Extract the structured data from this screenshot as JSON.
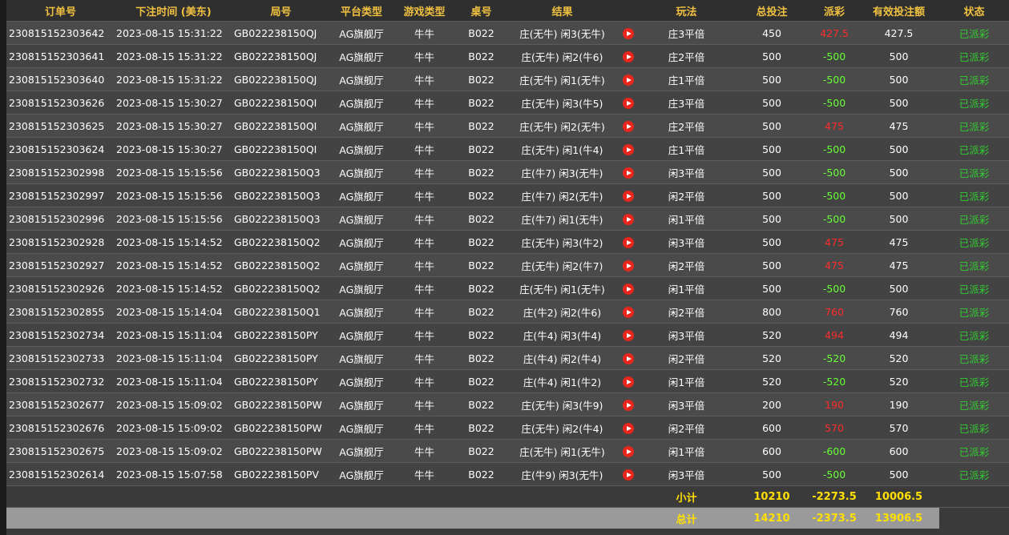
{
  "colors": {
    "header_text": "#f0c040",
    "win": "#ff2a2a",
    "loss": "#66ff33",
    "status": "#33cc33",
    "total_text": "#ffe000"
  },
  "headers": [
    "订单号",
    "下注时间 (美东)",
    "局号",
    "平台类型",
    "游戏类型",
    "桌号",
    "结果",
    "",
    "玩法",
    "总投注",
    "派彩",
    "有效投注额",
    "状态"
  ],
  "rows": [
    {
      "order": "230815152303642",
      "time": "2023-08-15 15:31:22",
      "round": "GB022238150QJ",
      "platform": "AG旗舰厅",
      "game": "牛牛",
      "table": "B022",
      "result": "庄(无牛) 闲3(无牛)",
      "play": "庄3平倍",
      "bet": "450",
      "payout": "427.5",
      "payout_type": "win",
      "valid": "427.5",
      "status": "已派彩"
    },
    {
      "order": "230815152303641",
      "time": "2023-08-15 15:31:22",
      "round": "GB022238150QJ",
      "platform": "AG旗舰厅",
      "game": "牛牛",
      "table": "B022",
      "result": "庄(无牛) 闲2(牛6)",
      "play": "庄2平倍",
      "bet": "500",
      "payout": "-500",
      "payout_type": "loss",
      "valid": "500",
      "status": "已派彩"
    },
    {
      "order": "230815152303640",
      "time": "2023-08-15 15:31:22",
      "round": "GB022238150QJ",
      "platform": "AG旗舰厅",
      "game": "牛牛",
      "table": "B022",
      "result": "庄(无牛) 闲1(无牛)",
      "play": "庄1平倍",
      "bet": "500",
      "payout": "-500",
      "payout_type": "loss",
      "valid": "500",
      "status": "已派彩"
    },
    {
      "order": "230815152303626",
      "time": "2023-08-15 15:30:27",
      "round": "GB022238150QI",
      "platform": "AG旗舰厅",
      "game": "牛牛",
      "table": "B022",
      "result": "庄(无牛) 闲3(牛5)",
      "play": "庄3平倍",
      "bet": "500",
      "payout": "-500",
      "payout_type": "loss",
      "valid": "500",
      "status": "已派彩"
    },
    {
      "order": "230815152303625",
      "time": "2023-08-15 15:30:27",
      "round": "GB022238150QI",
      "platform": "AG旗舰厅",
      "game": "牛牛",
      "table": "B022",
      "result": "庄(无牛) 闲2(无牛)",
      "play": "庄2平倍",
      "bet": "500",
      "payout": "475",
      "payout_type": "win",
      "valid": "475",
      "status": "已派彩"
    },
    {
      "order": "230815152303624",
      "time": "2023-08-15 15:30:27",
      "round": "GB022238150QI",
      "platform": "AG旗舰厅",
      "game": "牛牛",
      "table": "B022",
      "result": "庄(无牛) 闲1(牛4)",
      "play": "庄1平倍",
      "bet": "500",
      "payout": "-500",
      "payout_type": "loss",
      "valid": "500",
      "status": "已派彩"
    },
    {
      "order": "230815152302998",
      "time": "2023-08-15 15:15:56",
      "round": "GB022238150Q3",
      "platform": "AG旗舰厅",
      "game": "牛牛",
      "table": "B022",
      "result": "庄(牛7) 闲3(无牛)",
      "play": "闲3平倍",
      "bet": "500",
      "payout": "-500",
      "payout_type": "loss",
      "valid": "500",
      "status": "已派彩"
    },
    {
      "order": "230815152302997",
      "time": "2023-08-15 15:15:56",
      "round": "GB022238150Q3",
      "platform": "AG旗舰厅",
      "game": "牛牛",
      "table": "B022",
      "result": "庄(牛7) 闲2(无牛)",
      "play": "闲2平倍",
      "bet": "500",
      "payout": "-500",
      "payout_type": "loss",
      "valid": "500",
      "status": "已派彩"
    },
    {
      "order": "230815152302996",
      "time": "2023-08-15 15:15:56",
      "round": "GB022238150Q3",
      "platform": "AG旗舰厅",
      "game": "牛牛",
      "table": "B022",
      "result": "庄(牛7) 闲1(无牛)",
      "play": "闲1平倍",
      "bet": "500",
      "payout": "-500",
      "payout_type": "loss",
      "valid": "500",
      "status": "已派彩"
    },
    {
      "order": "230815152302928",
      "time": "2023-08-15 15:14:52",
      "round": "GB022238150Q2",
      "platform": "AG旗舰厅",
      "game": "牛牛",
      "table": "B022",
      "result": "庄(无牛) 闲3(牛2)",
      "play": "闲3平倍",
      "bet": "500",
      "payout": "475",
      "payout_type": "win",
      "valid": "475",
      "status": "已派彩"
    },
    {
      "order": "230815152302927",
      "time": "2023-08-15 15:14:52",
      "round": "GB022238150Q2",
      "platform": "AG旗舰厅",
      "game": "牛牛",
      "table": "B022",
      "result": "庄(无牛) 闲2(牛7)",
      "play": "闲2平倍",
      "bet": "500",
      "payout": "475",
      "payout_type": "win",
      "valid": "475",
      "status": "已派彩"
    },
    {
      "order": "230815152302926",
      "time": "2023-08-15 15:14:52",
      "round": "GB022238150Q2",
      "platform": "AG旗舰厅",
      "game": "牛牛",
      "table": "B022",
      "result": "庄(无牛) 闲1(无牛)",
      "play": "闲1平倍",
      "bet": "500",
      "payout": "-500",
      "payout_type": "loss",
      "valid": "500",
      "status": "已派彩"
    },
    {
      "order": "230815152302855",
      "time": "2023-08-15 15:14:04",
      "round": "GB022238150Q1",
      "platform": "AG旗舰厅",
      "game": "牛牛",
      "table": "B022",
      "result": "庄(牛2) 闲2(牛6)",
      "play": "闲2平倍",
      "bet": "800",
      "payout": "760",
      "payout_type": "win",
      "valid": "760",
      "status": "已派彩"
    },
    {
      "order": "230815152302734",
      "time": "2023-08-15 15:11:04",
      "round": "GB022238150PY",
      "platform": "AG旗舰厅",
      "game": "牛牛",
      "table": "B022",
      "result": "庄(牛4) 闲3(牛4)",
      "play": "闲3平倍",
      "bet": "520",
      "payout": "494",
      "payout_type": "win",
      "valid": "494",
      "status": "已派彩"
    },
    {
      "order": "230815152302733",
      "time": "2023-08-15 15:11:04",
      "round": "GB022238150PY",
      "platform": "AG旗舰厅",
      "game": "牛牛",
      "table": "B022",
      "result": "庄(牛4) 闲2(牛4)",
      "play": "闲2平倍",
      "bet": "520",
      "payout": "-520",
      "payout_type": "loss",
      "valid": "520",
      "status": "已派彩"
    },
    {
      "order": "230815152302732",
      "time": "2023-08-15 15:11:04",
      "round": "GB022238150PY",
      "platform": "AG旗舰厅",
      "game": "牛牛",
      "table": "B022",
      "result": "庄(牛4) 闲1(牛2)",
      "play": "闲1平倍",
      "bet": "520",
      "payout": "-520",
      "payout_type": "loss",
      "valid": "520",
      "status": "已派彩"
    },
    {
      "order": "230815152302677",
      "time": "2023-08-15 15:09:02",
      "round": "GB022238150PW",
      "platform": "AG旗舰厅",
      "game": "牛牛",
      "table": "B022",
      "result": "庄(无牛) 闲3(牛9)",
      "play": "闲3平倍",
      "bet": "200",
      "payout": "190",
      "payout_type": "win",
      "valid": "190",
      "status": "已派彩"
    },
    {
      "order": "230815152302676",
      "time": "2023-08-15 15:09:02",
      "round": "GB022238150PW",
      "platform": "AG旗舰厅",
      "game": "牛牛",
      "table": "B022",
      "result": "庄(无牛) 闲2(牛4)",
      "play": "闲2平倍",
      "bet": "600",
      "payout": "570",
      "payout_type": "win",
      "valid": "570",
      "status": "已派彩"
    },
    {
      "order": "230815152302675",
      "time": "2023-08-15 15:09:02",
      "round": "GB022238150PW",
      "platform": "AG旗舰厅",
      "game": "牛牛",
      "table": "B022",
      "result": "庄(无牛) 闲1(无牛)",
      "play": "闲1平倍",
      "bet": "600",
      "payout": "-600",
      "payout_type": "loss",
      "valid": "600",
      "status": "已派彩"
    },
    {
      "order": "230815152302614",
      "time": "2023-08-15 15:07:58",
      "round": "GB022238150PV",
      "platform": "AG旗舰厅",
      "game": "牛牛",
      "table": "B022",
      "result": "庄(牛9) 闲3(无牛)",
      "play": "闲3平倍",
      "bet": "500",
      "payout": "-500",
      "payout_type": "loss",
      "valid": "500",
      "status": "已派彩"
    }
  ],
  "subtotal": {
    "label": "小计",
    "bet": "10210",
    "payout": "-2273.5",
    "valid": "10006.5"
  },
  "grandtotal": {
    "label": "总计",
    "bet": "14210",
    "payout": "-2373.5",
    "valid": "13906.5"
  }
}
